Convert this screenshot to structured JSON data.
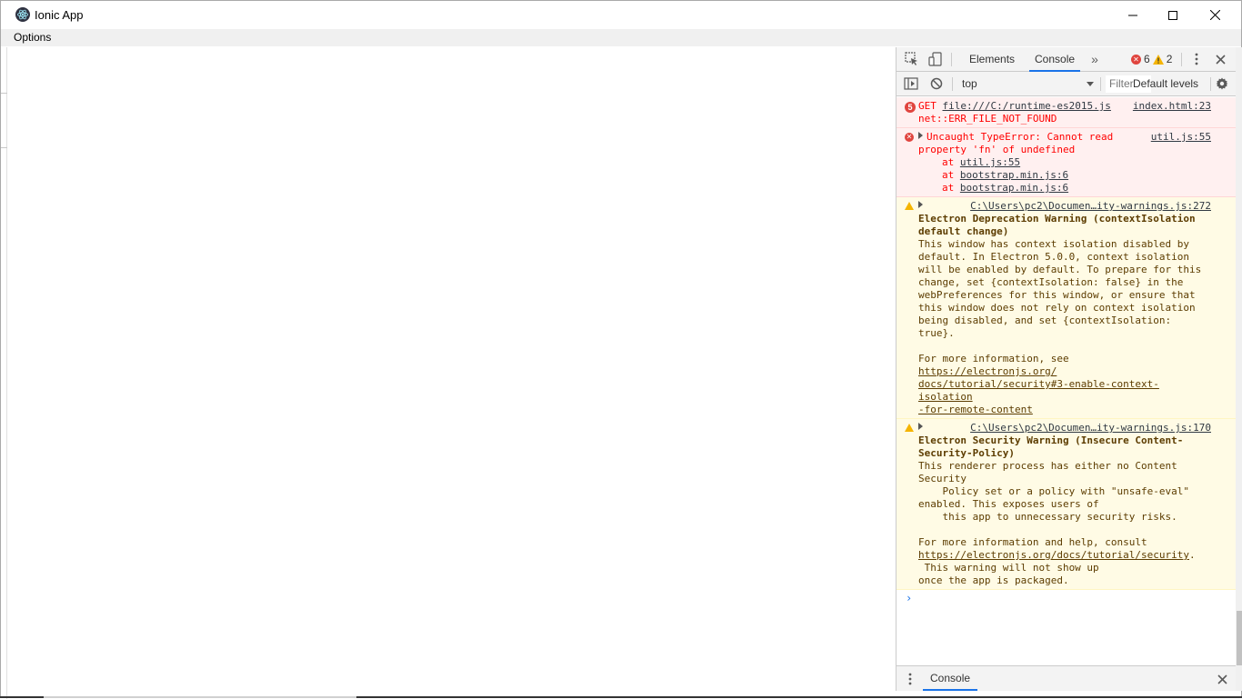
{
  "window": {
    "title": "Ionic App",
    "menu": [
      "Options"
    ]
  },
  "devtools": {
    "tabs": [
      "Elements",
      "Console"
    ],
    "active_tab": "Console",
    "error_count": "6",
    "warning_count": "2",
    "context": "top",
    "filter_placeholder": "Filter",
    "levels_label": "Default levels",
    "drawer_tab": "Console",
    "messages": {
      "m1": {
        "badge": "5",
        "text1": "GET ",
        "link": "file:///C:/runtime-es2015.js",
        "text2": "net::ERR_FILE_NOT_FOUND",
        "source": "index.html:23"
      },
      "m2": {
        "line1": "Uncaught TypeError: Cannot read",
        "line2": "property 'fn' of undefined",
        "at": "at",
        "st1": "util.js:55",
        "st2": "bootstrap.min.js:6",
        "st3": "bootstrap.min.js:6",
        "source": "util.js:55"
      },
      "m3": {
        "source": "C:\\Users\\pc2\\Documen…ity-warnings.js:272",
        "title1": "Electron Deprecation Warning (contextIsolation",
        "title2": "default change)",
        "body": [
          "This window has context isolation disabled by",
          "default. In Electron 5.0.0, context isolation",
          "will be enabled by default. To prepare for this",
          "change, set {contextIsolation: false} in the",
          "webPreferences for this window, or ensure that",
          "this window does not rely on context isolation",
          "being disabled, and set {contextIsolation: true}."
        ],
        "more_prefix": "For more information, see ",
        "link1": "https://electronjs.org/",
        "link2": "docs/tutorial/security#3-enable-context-isolation",
        "link3": "-for-remote-content"
      },
      "m4": {
        "source": "C:\\Users\\pc2\\Documen…ity-warnings.js:170",
        "title1": "Electron Security Warning (Insecure Content-",
        "title2": "Security-Policy)",
        "body": [
          "This renderer process has either no Content",
          "Security",
          "    Policy set or a policy with \"unsafe-eval\"",
          "enabled. This exposes users of",
          "    this app to unnecessary security risks."
        ],
        "more": "For more information and help, consult",
        "link": "https://electronjs.org/docs/tutorial/security",
        "link_suffix": ".",
        "tail1": " This warning will not show up",
        "tail2": "once the app is packaged."
      }
    }
  },
  "colors": {
    "accent": "#1a73e8",
    "error": "#ff0000",
    "warning_bg": "#fffbe5",
    "error_bg": "#fff0f0"
  }
}
